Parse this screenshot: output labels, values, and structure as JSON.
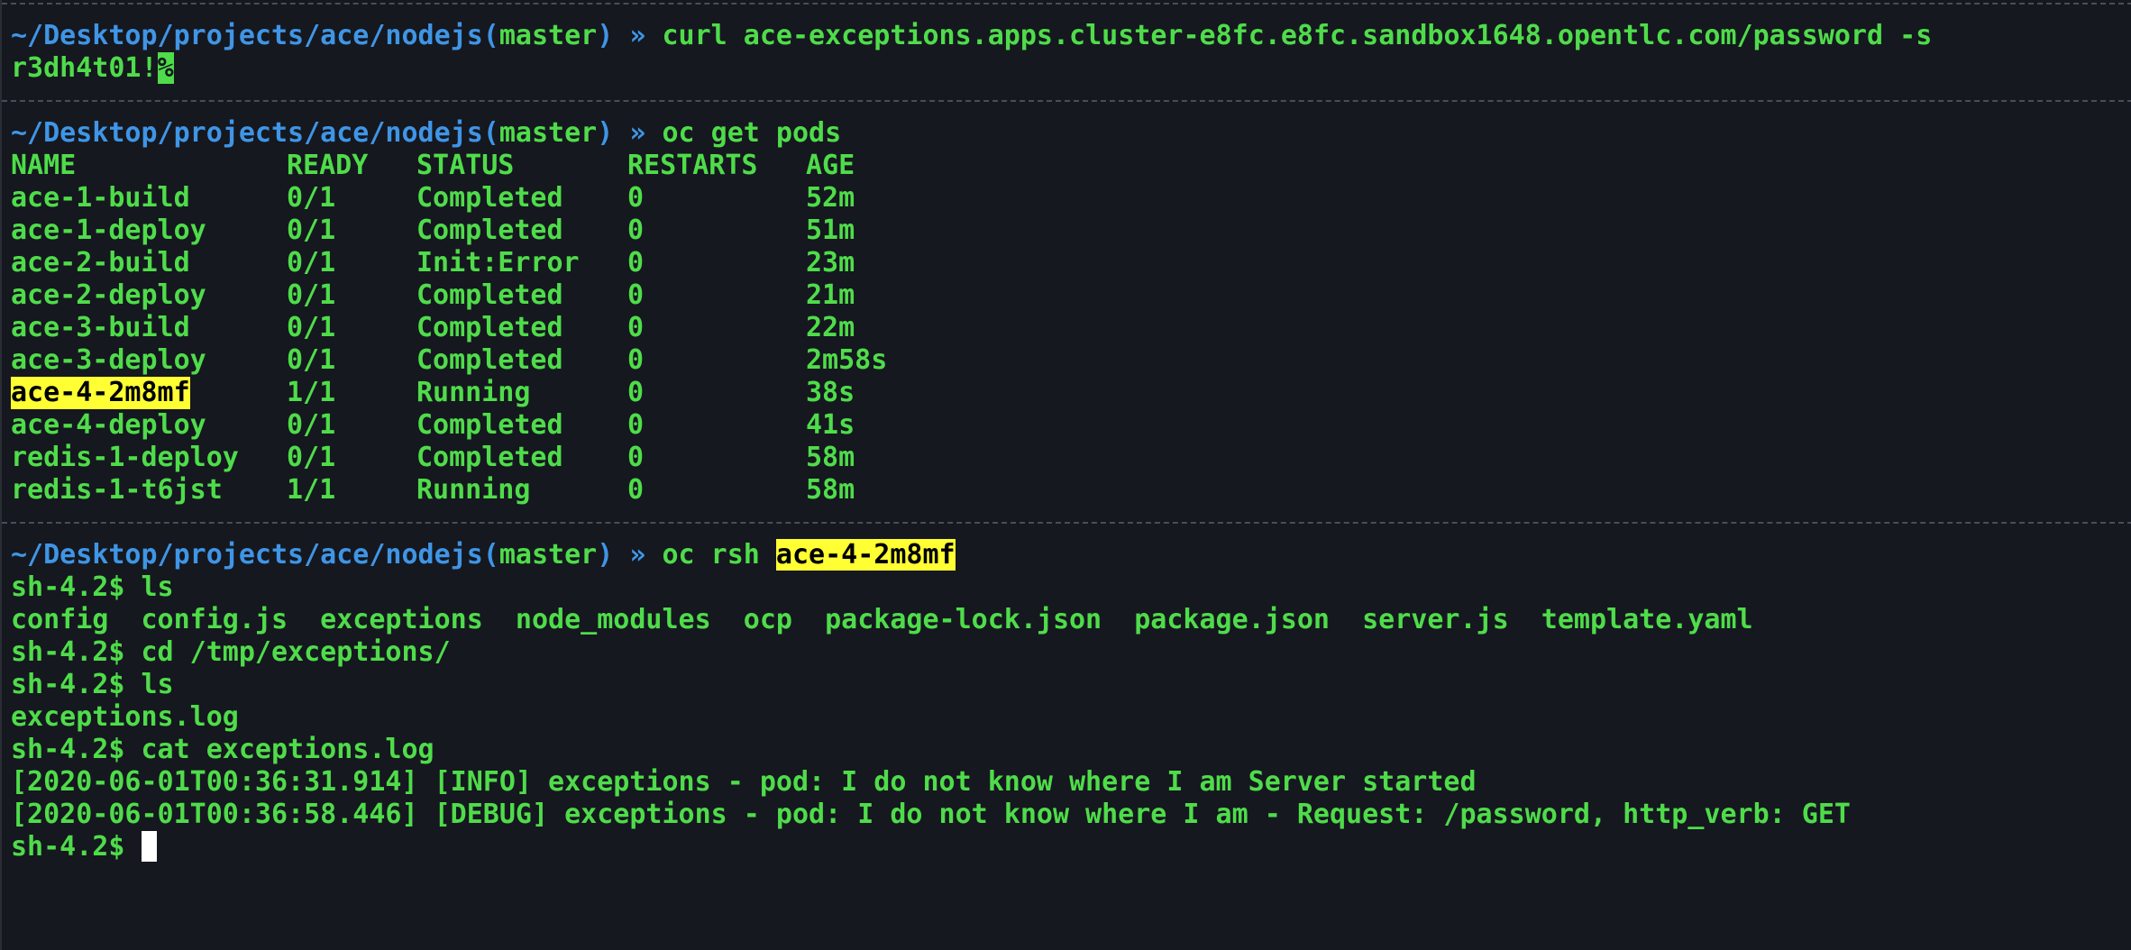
{
  "prompt": {
    "path": "~/Desktop/projects/ace/nodejs",
    "open_paren": "(",
    "branch": "master",
    "close_paren": ")",
    "chevron": "»"
  },
  "block1": {
    "command": "curl ace-exceptions.apps.cluster-e8fc.e8fc.sandbox1648.opentlc.com/password -s",
    "output": "r3dh4t01!",
    "eol_marker": "%"
  },
  "block2": {
    "command": "oc get pods",
    "table": {
      "headers": [
        "NAME",
        "READY",
        "STATUS",
        "RESTARTS",
        "AGE"
      ],
      "rows": [
        {
          "name": "ace-1-build",
          "ready": "0/1",
          "status": "Completed",
          "restarts": "0",
          "age": "52m"
        },
        {
          "name": "ace-1-deploy",
          "ready": "0/1",
          "status": "Completed",
          "restarts": "0",
          "age": "51m"
        },
        {
          "name": "ace-2-build",
          "ready": "0/1",
          "status": "Init:Error",
          "restarts": "0",
          "age": "23m"
        },
        {
          "name": "ace-2-deploy",
          "ready": "0/1",
          "status": "Completed",
          "restarts": "0",
          "age": "21m"
        },
        {
          "name": "ace-3-build",
          "ready": "0/1",
          "status": "Completed",
          "restarts": "0",
          "age": "22m"
        },
        {
          "name": "ace-3-deploy",
          "ready": "0/1",
          "status": "Completed",
          "restarts": "0",
          "age": "2m58s"
        },
        {
          "name": "ace-4-2m8mf",
          "ready": "1/1",
          "status": "Running",
          "restarts": "0",
          "age": "38s"
        },
        {
          "name": "ace-4-deploy",
          "ready": "0/1",
          "status": "Completed",
          "restarts": "0",
          "age": "41s"
        },
        {
          "name": "redis-1-deploy",
          "ready": "0/1",
          "status": "Completed",
          "restarts": "0",
          "age": "58m"
        },
        {
          "name": "redis-1-t6jst",
          "ready": "1/1",
          "status": "Running",
          "restarts": "0",
          "age": "58m"
        }
      ]
    }
  },
  "block3": {
    "command_prefix": "oc rsh ",
    "command_pod": "ace-4-2m8mf",
    "lines": [
      "sh-4.2$ ls",
      "config  config.js  exceptions  node_modules  ocp  package-lock.json  package.json  server.js  template.yaml",
      "sh-4.2$ cd /tmp/exceptions/",
      "sh-4.2$ ls",
      "exceptions.log",
      "sh-4.2$ cat exceptions.log",
      "[2020-06-01T00:36:31.914] [INFO] exceptions - pod: I do not know where I am Server started",
      "[2020-06-01T00:36:58.446] [DEBUG] exceptions - pod: I do not know where I am - Request: /password, http_verb: GET"
    ],
    "final_prompt": "sh-4.2$ "
  },
  "colors": {
    "background": "#15181f",
    "text_green": "#4fdc4a",
    "path_blue": "#3f95e6",
    "highlight_yellow": "#ffff33",
    "separator": "#4a4d55",
    "cursor": "#ffffff"
  }
}
